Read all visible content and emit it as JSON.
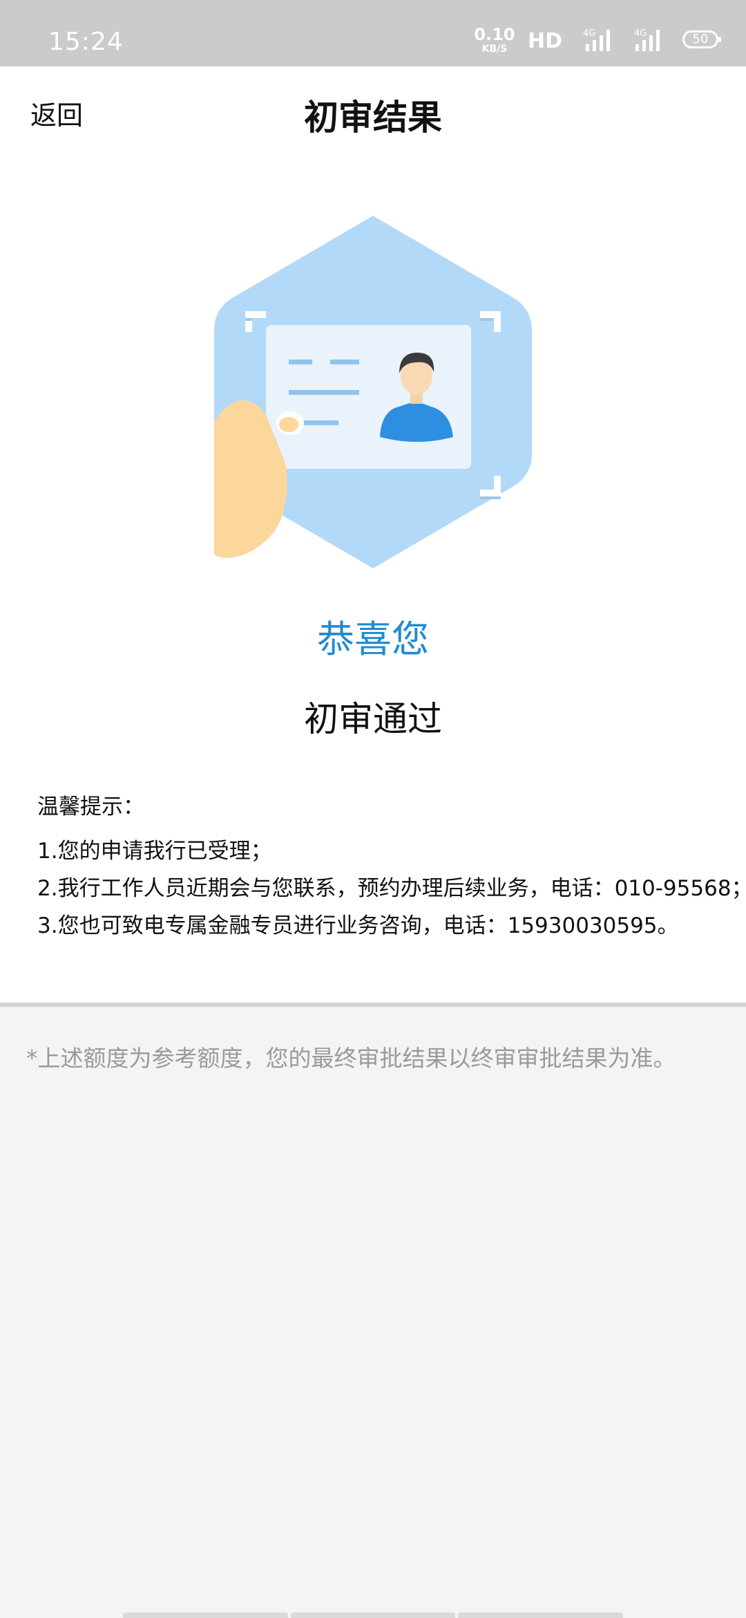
{
  "status_bar": {
    "time": "15:24",
    "net_speed_value": "0.10",
    "net_speed_unit": "KB/S",
    "hd_label": "HD",
    "signal_1_label": "4G",
    "signal_2_label": "4G",
    "battery": "50"
  },
  "nav": {
    "back_label": "返回",
    "title": "初审结果"
  },
  "hero": {
    "icon": "id-card-in-hand-illustration",
    "colors": {
      "hexagon": "#b3d9f8",
      "card": "#eaf3fc",
      "avatar": "#2e8fe0",
      "hand": "#fbd79c"
    }
  },
  "result": {
    "congrats": "恭喜您",
    "status": "初审通过"
  },
  "tips": {
    "heading": "温馨提示：",
    "items": [
      "1.您的申请我行已受理；",
      "2.我行工作人员近期会与您联系，预约办理后续业务，电话：010-95568；",
      "3.您也可致电专属金融专员进行业务咨询，电话：15930030595。"
    ]
  },
  "footer": {
    "disclaimer": "*上述额度为参考额度，您的最终审批结果以终审审批结果为准。"
  },
  "colors": {
    "accent": "#1e8bd2",
    "status_bar_bg": "#cbcbcb",
    "page_bg": "#f4f4f4"
  }
}
